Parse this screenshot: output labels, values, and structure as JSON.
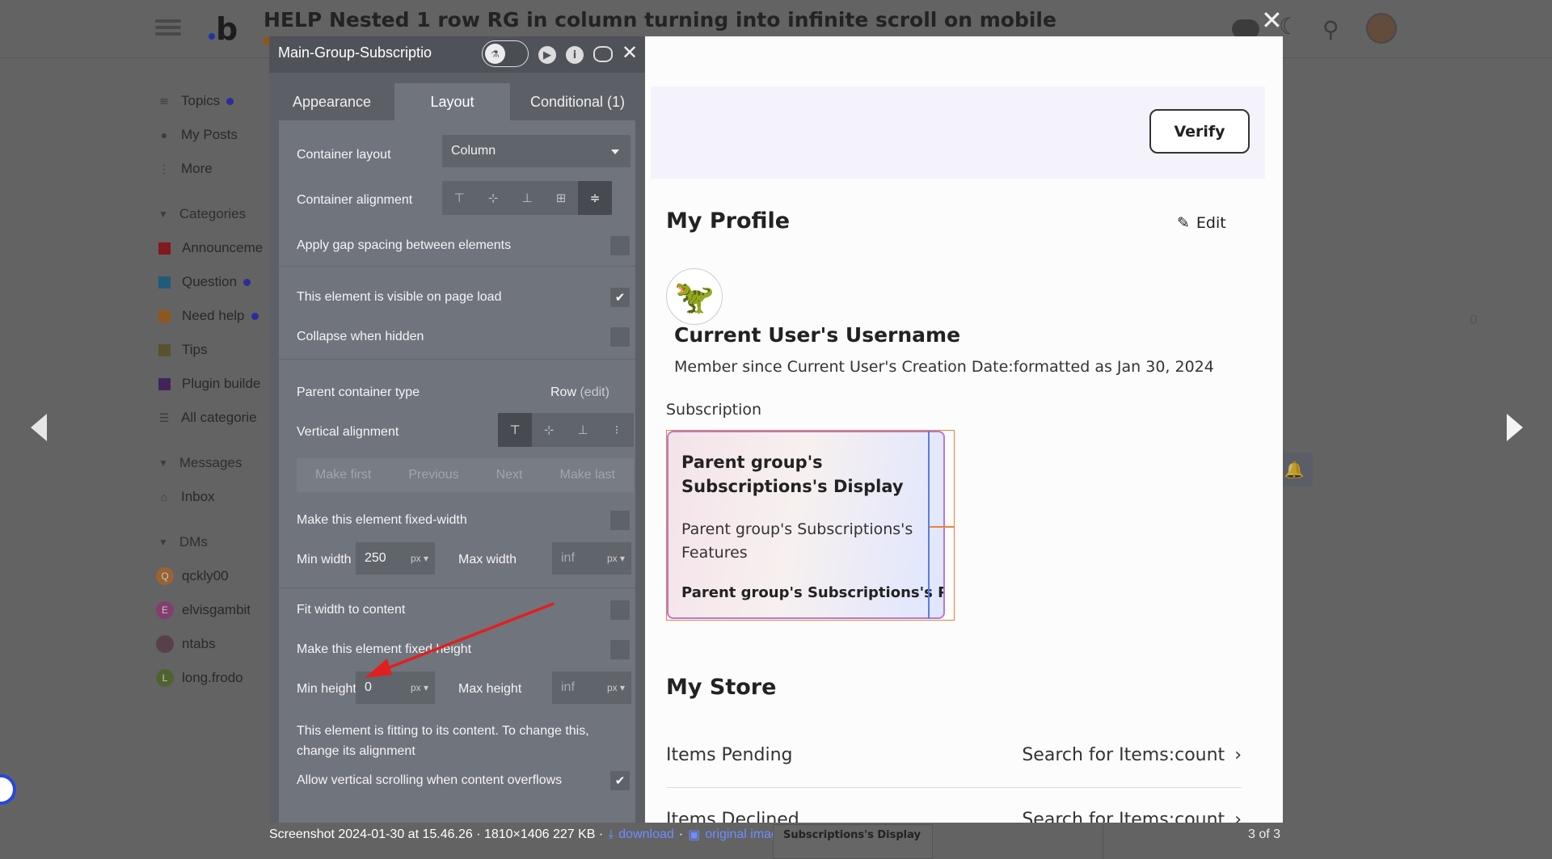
{
  "forum": {
    "topic_title": "HELP Nested 1 row RG in column turning into infinite scroll on mobile",
    "sidebar": {
      "items": [
        {
          "label": "Topics",
          "icon": "layers-icon",
          "dot": true
        },
        {
          "label": "My Posts",
          "icon": "user-icon",
          "dot": false
        },
        {
          "label": "More",
          "icon": "more-vertical-icon",
          "dot": false
        }
      ],
      "categories_heading": "Categories",
      "categories": [
        {
          "label": "Announceme",
          "color": "#a3151c",
          "dot": false
        },
        {
          "label": "Question",
          "color": "#1e6f9a",
          "dot": true
        },
        {
          "label": "Need help",
          "color": "#b86a1e",
          "dot": true
        },
        {
          "label": "Tips",
          "color": "#6e6233",
          "dot": false
        },
        {
          "label": "Plugin builde",
          "color": "#4e236c",
          "dot": false
        },
        {
          "label": "All categorie",
          "color": "",
          "dot": false
        }
      ],
      "messages_heading": "Messages",
      "inbox_label": "Inbox",
      "dms_heading": "DMs",
      "dms": [
        {
          "label": "qckly00",
          "initial": "Q",
          "color": "#c77a3a"
        },
        {
          "label": "elvisgambit",
          "initial": "E",
          "color": "#a5478b"
        },
        {
          "label": "ntabs",
          "initial": "",
          "color": "#6a4a5a"
        },
        {
          "label": "long.frodo",
          "initial": "L",
          "color": "#5f7a33"
        }
      ],
      "faint_right_text": "0"
    }
  },
  "editor": {
    "element_name": "Main-Group-Subscriptio",
    "tabs": [
      "Appearance",
      "Layout",
      "Conditional (1)"
    ],
    "active_tab": "Layout",
    "container_layout_label": "Container layout",
    "container_layout_value": "Column",
    "container_alignment_label": "Container alignment",
    "apply_gap_label": "Apply gap spacing between elements",
    "visible_on_load_label": "This element is visible on page load",
    "collapse_hidden_label": "Collapse when hidden",
    "parent_container_label": "Parent container type",
    "parent_container_value": "Row",
    "parent_container_edit": "(edit)",
    "vertical_alignment_label": "Vertical alignment",
    "order_buttons": [
      "Make first",
      "Previous",
      "Next",
      "Make last"
    ],
    "fixed_width_label": "Make this element fixed-width",
    "min_width_label": "Min width",
    "min_width_value": "250",
    "max_width_label": "Max width",
    "max_width_value": "inf",
    "unit": "px",
    "fit_width_label": "Fit width to content",
    "fixed_height_label": "Make this element fixed height",
    "min_height_label": "Min height",
    "min_height_value": "0",
    "max_height_label": "Max height",
    "max_height_value": "inf",
    "fitting_note": "This element is fitting to its content. To change this, change its alignment",
    "allow_scroll_label": "Allow vertical scrolling when content overflows",
    "annotation_color": "#e02020"
  },
  "app": {
    "verify_label": "Verify",
    "profile_heading": "My Profile",
    "edit_label": "Edit",
    "username": "Current User's Username",
    "member_since": "Member since Current User's Creation Date:formatted as Jan 30, 2024",
    "subscription_label": "Subscription",
    "rg_title": "Parent group's Subscriptions's Display",
    "rg_features": "Parent group's Subscriptions's Features",
    "rg_price": "Parent group's Subscriptions's Pri",
    "store_heading": "My Store",
    "store_rows": [
      {
        "label": "Items Pending",
        "value": "Search for Items:count"
      },
      {
        "label": "Items Declined",
        "value": "Search for Items:count"
      }
    ]
  },
  "lightbox": {
    "caption_text": "Screenshot 2024-01-30 at 15.46.26 · 1810×1406 227 KB ·",
    "download_label": "download",
    "original_label": "original image",
    "page_count": "3 of 3",
    "thumb_text": "Subscriptions's Display"
  }
}
